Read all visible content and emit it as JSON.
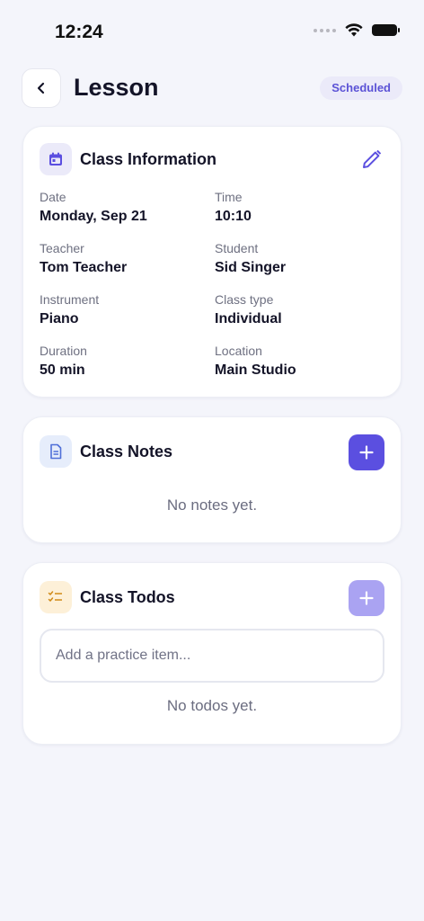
{
  "status_bar": {
    "time": "12:24"
  },
  "header": {
    "title": "Lesson",
    "status_badge": "Scheduled"
  },
  "class_info": {
    "title": "Class Information",
    "fields": [
      {
        "label": "Date",
        "value": "Monday, Sep 21"
      },
      {
        "label": "Time",
        "value": "10:10"
      },
      {
        "label": "Teacher",
        "value": "Tom Teacher"
      },
      {
        "label": "Student",
        "value": "Sid Singer"
      },
      {
        "label": "Instrument",
        "value": "Piano"
      },
      {
        "label": "Class type",
        "value": "Individual"
      },
      {
        "label": "Duration",
        "value": "50 min"
      },
      {
        "label": "Location",
        "value": "Main Studio"
      }
    ]
  },
  "class_notes": {
    "title": "Class Notes",
    "empty_text": "No notes yet."
  },
  "class_todos": {
    "title": "Class Todos",
    "input_placeholder": "Add a practice item...",
    "empty_text": "No todos yet."
  },
  "colors": {
    "accent": "#5b4fe0",
    "accent_disabled": "#aaa3f2",
    "badge_bg": "#ebeaf9",
    "notes_icon_bg": "#e6edfb",
    "todos_icon_bg": "#fdf0d8"
  },
  "icons": {
    "back": "chevron-left-icon",
    "edit": "pencil-icon",
    "calendar": "calendar-icon",
    "notes": "document-icon",
    "todos": "checklist-icon",
    "add": "plus-icon"
  }
}
